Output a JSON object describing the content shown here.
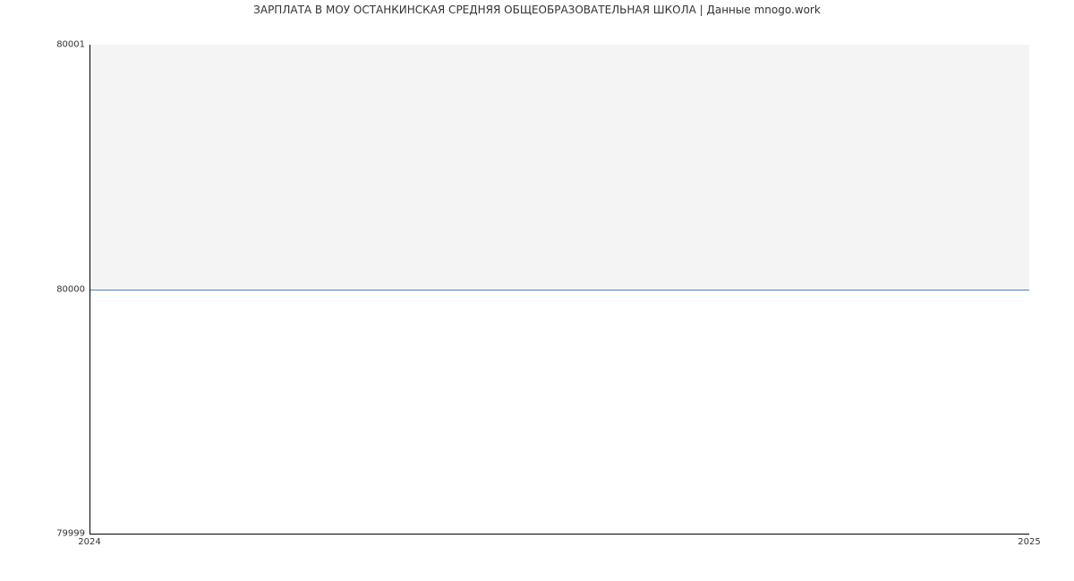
{
  "chart_data": {
    "type": "area",
    "title": "ЗАРПЛАТА В МОУ ОСТАНКИНСКАЯ СРЕДНЯЯ ОБЩЕОБРАЗОВАТЕЛЬНАЯ ШКОЛА | Данные mnogo.work",
    "x": [
      2024,
      2025
    ],
    "values": [
      80000,
      80000
    ],
    "xlabel": "",
    "ylabel": "",
    "ylim": [
      79999,
      80001
    ],
    "xlim": [
      2024,
      2025
    ],
    "y_ticks": [
      "79999",
      "80000",
      "80001"
    ],
    "x_ticks": [
      "2024",
      "2025"
    ],
    "line_color": "#4a7ecb",
    "fill_color": "#f4f4f4"
  }
}
